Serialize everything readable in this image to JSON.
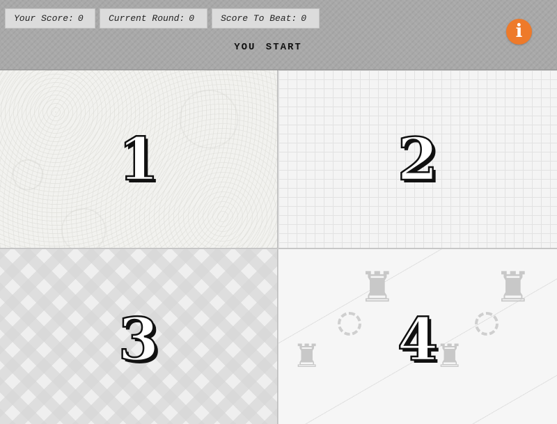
{
  "scoreboard": {
    "your_score_label": "Your Score:",
    "your_score_value": "0",
    "current_round_label": "Current Round:",
    "current_round_value": "0",
    "score_to_beat_label": "Score To Beat:",
    "score_to_beat_value": "0"
  },
  "status": "YOU START",
  "info_button": {
    "icon": "info-icon",
    "glyph": "i",
    "color": "#ee7a2a"
  },
  "tiles": [
    {
      "label": "1"
    },
    {
      "label": "2"
    },
    {
      "label": "3"
    },
    {
      "label": "4"
    }
  ]
}
